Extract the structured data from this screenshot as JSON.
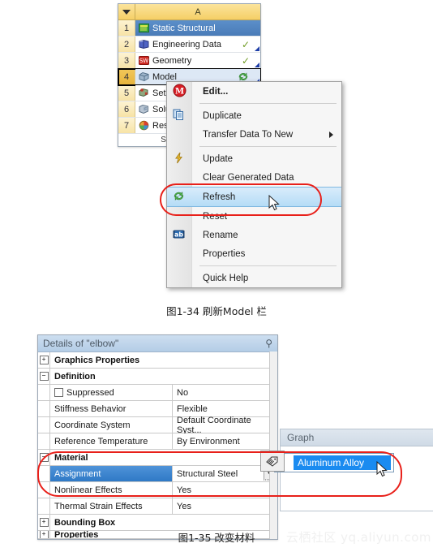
{
  "figure1": {
    "schematic": {
      "column_header": "A",
      "dropdown_icon": "triangle-down-icon",
      "rows": [
        {
          "num": "1",
          "label": "Static Structural",
          "icon": "static-structural-icon",
          "state": "selected",
          "check": "",
          "corner": false
        },
        {
          "num": "2",
          "label": "Engineering Data",
          "icon": "engineering-data-icon",
          "state": "normal",
          "check": "✓",
          "corner": true
        },
        {
          "num": "3",
          "label": "Geometry",
          "icon": "geometry-icon",
          "state": "normal",
          "check": "✓",
          "corner": true
        },
        {
          "num": "4",
          "label": "Model",
          "icon": "model-icon",
          "state": "active",
          "check": "refresh",
          "corner": true
        },
        {
          "num": "5",
          "label": "Setup",
          "icon": "setup-icon",
          "state": "normal",
          "check": "",
          "corner": false
        },
        {
          "num": "6",
          "label": "Solution",
          "icon": "solution-icon",
          "state": "normal",
          "check": "",
          "corner": false
        },
        {
          "num": "7",
          "label": "Results",
          "icon": "results-icon",
          "state": "normal",
          "check": "",
          "corner": false
        }
      ],
      "footer": "Static Structural"
    },
    "context_menu": {
      "items": [
        {
          "label": "Edit...",
          "icon": "mechanical-m-icon",
          "bold": true,
          "highlight": false,
          "submenu": false
        },
        {
          "sep": true
        },
        {
          "label": "Duplicate",
          "icon": "duplicate-icon",
          "bold": false,
          "highlight": false,
          "submenu": false
        },
        {
          "label": "Transfer Data To New",
          "icon": "",
          "bold": false,
          "highlight": false,
          "submenu": true
        },
        {
          "sep": true
        },
        {
          "label": "Update",
          "icon": "lightning-icon",
          "bold": false,
          "highlight": false,
          "submenu": false
        },
        {
          "label": "Clear Generated Data",
          "icon": "",
          "bold": false,
          "highlight": false,
          "submenu": false
        },
        {
          "label": "Refresh",
          "icon": "refresh-icon",
          "bold": false,
          "highlight": true,
          "submenu": false
        },
        {
          "label": "Reset",
          "icon": "",
          "bold": false,
          "highlight": false,
          "submenu": false
        },
        {
          "sep": false
        },
        {
          "label": "Rename",
          "icon": "rename-ab-icon",
          "bold": false,
          "highlight": false,
          "submenu": false
        },
        {
          "label": "Properties",
          "icon": "",
          "bold": false,
          "highlight": false,
          "submenu": false
        },
        {
          "sep": true
        },
        {
          "label": "Quick Help",
          "icon": "",
          "bold": false,
          "highlight": false,
          "submenu": false
        }
      ]
    },
    "annotation_color": "#e8201a",
    "caption": "图1-34 刷新Model 栏"
  },
  "figure2": {
    "details_panel": {
      "title": "Details of \"elbow\"",
      "pin_icon": "pin-icon",
      "rows": [
        {
          "type": "group",
          "expander": "+",
          "name": "Graphics Properties"
        },
        {
          "type": "group",
          "expander": "−",
          "name": "Definition"
        },
        {
          "type": "prop",
          "key": "Suppressed",
          "value": "No",
          "checkbox": true
        },
        {
          "type": "prop",
          "key": "Stiffness Behavior",
          "value": "Flexible"
        },
        {
          "type": "prop",
          "key": "Coordinate System",
          "value": "Default Coordinate Syst..."
        },
        {
          "type": "prop",
          "key": "Reference Temperature",
          "value": "By Environment"
        },
        {
          "type": "group",
          "expander": "−",
          "name": "Material"
        },
        {
          "type": "prop",
          "key": "Assignment",
          "value": "Structural Steel",
          "selected": true,
          "dropdown": true
        },
        {
          "type": "prop",
          "key": "Nonlinear Effects",
          "value": "Yes"
        },
        {
          "type": "prop",
          "key": "Thermal Strain Effects",
          "value": "Yes"
        },
        {
          "type": "group",
          "expander": "+",
          "name": "Bounding Box"
        },
        {
          "type": "group",
          "expander": "+",
          "name": "Properties"
        }
      ]
    },
    "graph_panel": {
      "title": "Graph"
    },
    "dropdown": {
      "icon": "material-tag-icon",
      "selected_option": "Aluminum Alloy"
    },
    "annotation_color": "#e8201a",
    "caption": "图1-35 改变材料"
  },
  "watermark": "云栖社区 yq.aliyun.com"
}
